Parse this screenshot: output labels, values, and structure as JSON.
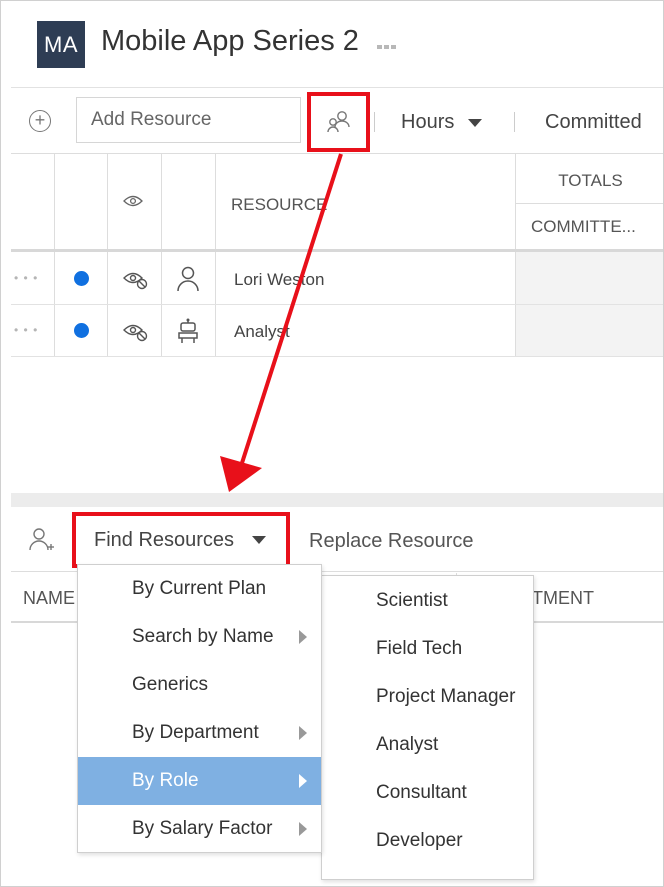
{
  "header": {
    "avatar_initials": "MA",
    "title": "Mobile App Series 2",
    "more_glyph": "▪▪▪"
  },
  "toolbar": {
    "add_placeholder": "Add Resource",
    "hours_label": "Hours",
    "committed_label": "Committed"
  },
  "grid": {
    "columns": {
      "resource": "RESOURCE",
      "totals": "TOTALS",
      "committed": "COMMITTE..."
    },
    "rows": [
      {
        "menu_dots": "• • •",
        "name": "Lori Weston",
        "type_icon": "person-icon"
      },
      {
        "menu_dots": "• • •",
        "name": "Analyst",
        "type_icon": "robot-icon"
      }
    ]
  },
  "lower": {
    "find_resources_label": "Find Resources",
    "replace_resource_label": "Replace Resource",
    "name_column": "NAME",
    "department_column_fragment": "TMENT"
  },
  "find_menu": {
    "items": [
      {
        "label": "By Current Plan",
        "has_submenu": false,
        "active": false
      },
      {
        "label": "Search by Name",
        "has_submenu": true,
        "active": false
      },
      {
        "label": "Generics",
        "has_submenu": false,
        "active": false
      },
      {
        "label": "By Department",
        "has_submenu": true,
        "active": false
      },
      {
        "label": "By Role",
        "has_submenu": true,
        "active": true
      },
      {
        "label": "By Salary Factor",
        "has_submenu": true,
        "active": false
      }
    ]
  },
  "role_submenu": {
    "items": [
      "Scientist",
      "Field Tech",
      "Project Manager",
      "Analyst",
      "Consultant",
      "Developer"
    ]
  },
  "colors": {
    "annotation_red": "#e8101a",
    "active_menu_bg": "#7fb0e2",
    "status_blue": "#1070e0",
    "avatar_bg": "#2e3d54"
  }
}
